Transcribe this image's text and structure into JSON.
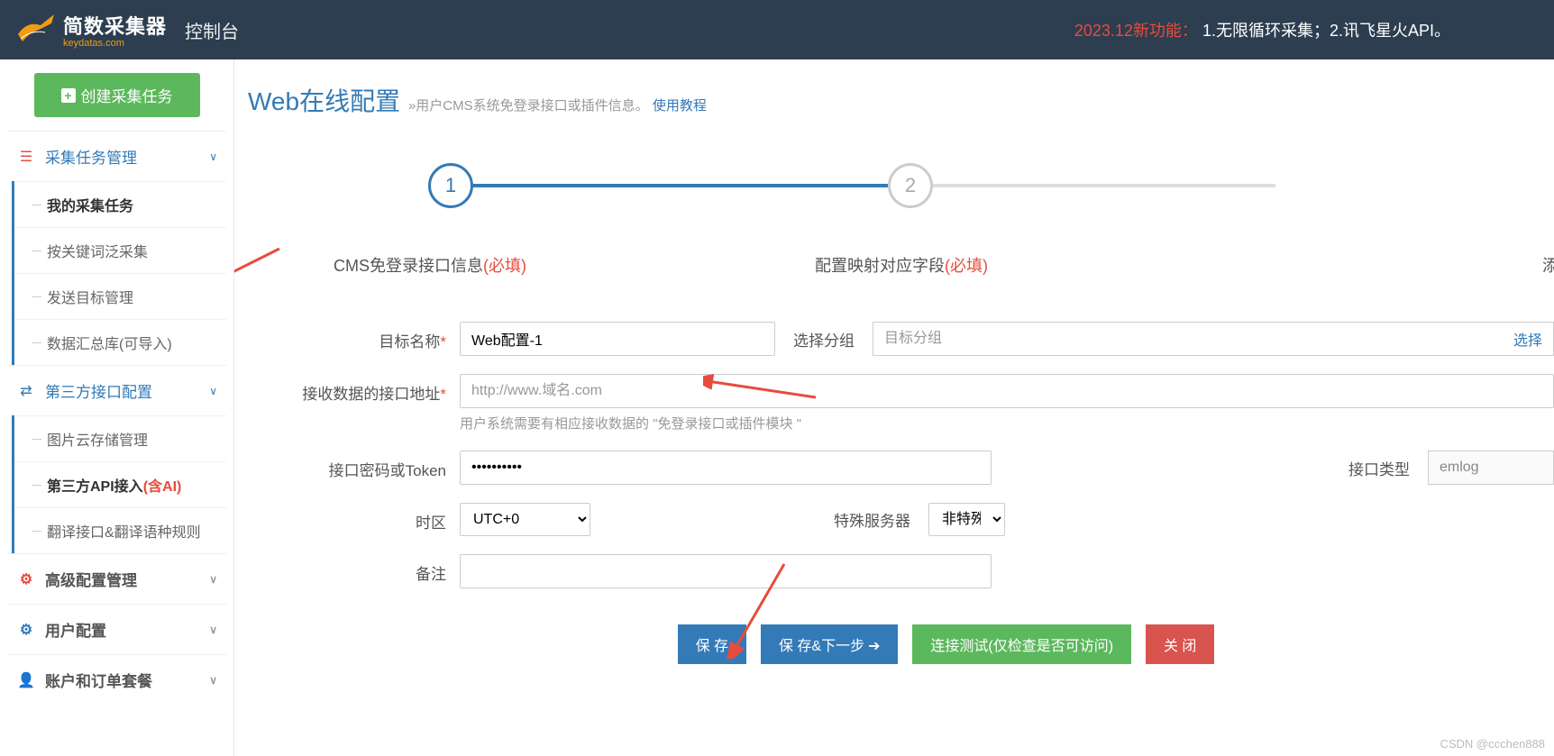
{
  "header": {
    "logo_main": "简数采集器",
    "logo_sub": "keydatas.com",
    "console": "控制台",
    "announce_red": "2023.12新功能：",
    "announce_white": "1.无限循环采集；2.讯飞星火API。"
  },
  "sidebar": {
    "create_btn": "创建采集任务",
    "sections": [
      {
        "title": "采集任务管理",
        "items": [
          "我的采集任务",
          "按关键词泛采集",
          "发送目标管理",
          "数据汇总库(可导入)"
        ]
      },
      {
        "title": "第三方接口配置",
        "items": [
          "图片云存储管理",
          "第三方API接入",
          "翻译接口&翻译语种规则"
        ],
        "ai_suffix": "(含AI)"
      },
      {
        "title": "高级配置管理"
      },
      {
        "title": "用户配置"
      },
      {
        "title": "账户和订单套餐"
      }
    ]
  },
  "page": {
    "title": "Web在线配置",
    "subtitle_prefix": "»用户CMS系统免登录接口或插件信息。",
    "subtitle_link": "使用教程"
  },
  "steps": {
    "s1_num": "1",
    "s1_label": "CMS免登录接口信息",
    "s2_num": "2",
    "s2_label": "配置映射对应字段",
    "s3_label": "添",
    "required": "(必填)"
  },
  "form": {
    "target_name_label": "目标名称",
    "target_name_value": "Web配置-1",
    "group_label": "选择分组",
    "group_placeholder": "目标分组",
    "group_select": "选择",
    "api_url_label": "接收数据的接口地址",
    "api_url_placeholder": "http://www.域名.com",
    "api_url_hint": "用户系统需要有相应接收数据的 \"免登录接口或插件模块 \"",
    "token_label": "接口密码或Token",
    "token_value": "••••••••••",
    "api_type_label": "接口类型",
    "api_type_value": "emlog",
    "tz_label": "时区",
    "tz_value": "UTC+0",
    "server_label": "特殊服务器",
    "server_value": "非特殊",
    "remark_label": "备注"
  },
  "actions": {
    "save": "保 存",
    "save_next": "保 存&下一步",
    "test": "连接测试(仅检查是否可访问)",
    "close": "关 闭"
  },
  "watermark": "CSDN @ccchen888"
}
